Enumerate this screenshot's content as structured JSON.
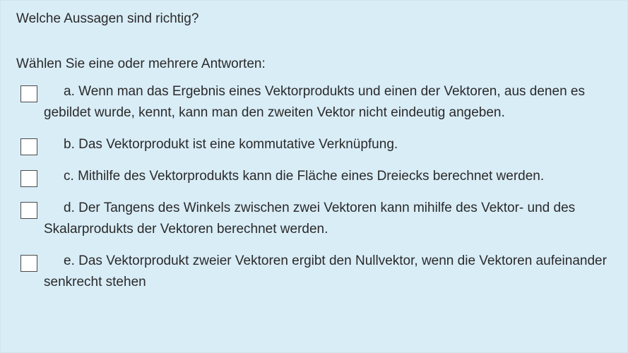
{
  "question": {
    "title": "Welche Aussagen sind richtig?",
    "instruction": "Wählen Sie eine oder mehrere Antworten:"
  },
  "answers": [
    {
      "letter": "a.",
      "text": "Wenn man das Ergebnis eines Vektorprodukts und einen der Vektoren, aus denen es gebildet wurde, kennt, kann man den zweiten Vektor nicht eindeutig angeben.",
      "checked": false
    },
    {
      "letter": "b.",
      "text": "Das Vektorprodukt ist eine kommutative Verknüpfung.",
      "checked": false
    },
    {
      "letter": "c.",
      "text": "Mithilfe des Vektorprodukts kann die Fläche eines Dreiecks berechnet werden.",
      "checked": false
    },
    {
      "letter": "d.",
      "text": "Der Tangens des Winkels zwischen zwei Vektoren kann mihilfe des Vektor- und des Skalarprodukts der Vektoren berechnet werden.",
      "checked": false
    },
    {
      "letter": "e.",
      "text": "Das Vektorprodukt zweier Vektoren ergibt den Nullvektor, wenn die Vektoren aufeinander senkrecht stehen",
      "checked": false
    }
  ],
  "colors": {
    "background": "#d9edf7",
    "text": "#2a2a2a",
    "checkbox_border": "#4a4a4a"
  }
}
